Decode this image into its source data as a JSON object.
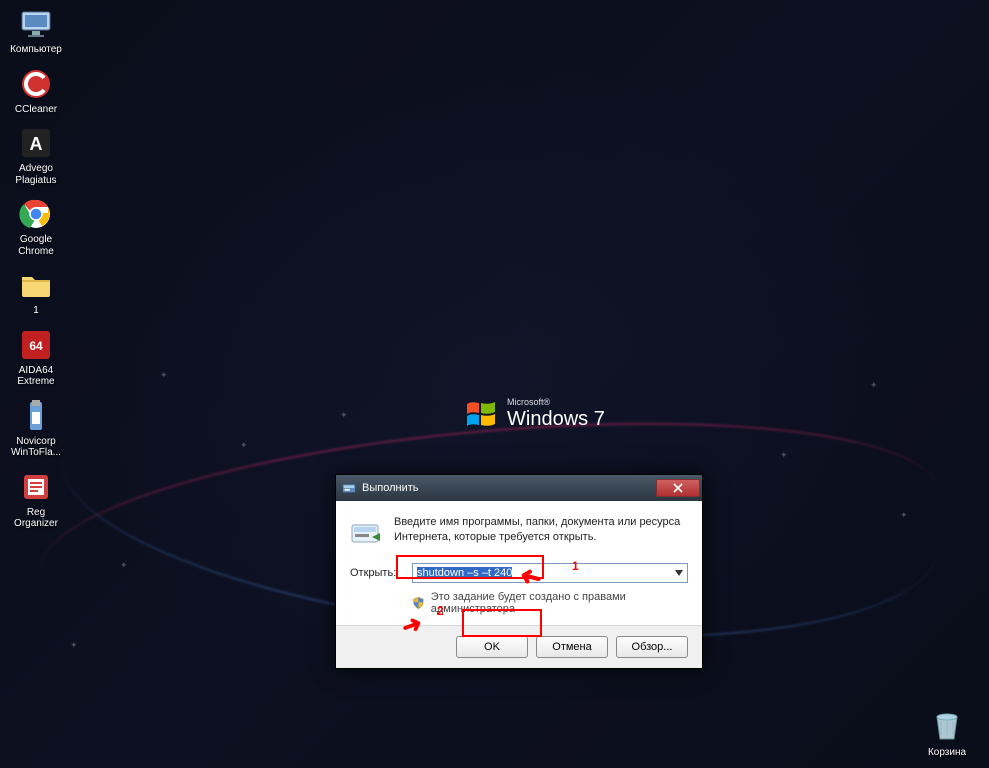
{
  "wallpaper": {
    "brand_small": "Microsoft®",
    "brand_large": "Windows 7"
  },
  "desktop": {
    "icons": [
      {
        "label": "Компьютер",
        "name": "computer-icon"
      },
      {
        "label": "CCleaner",
        "name": "ccleaner-icon"
      },
      {
        "label": "Advego Plagiatus",
        "name": "advego-icon"
      },
      {
        "label": "Google Chrome",
        "name": "chrome-icon"
      },
      {
        "label": "1",
        "name": "folder-icon"
      },
      {
        "label": "AIDA64 Extreme",
        "name": "aida64-icon"
      },
      {
        "label": "Novicorp WinToFla...",
        "name": "wintoflash-icon"
      },
      {
        "label": "Reg Organizer",
        "name": "regorganizer-icon"
      }
    ],
    "recycle_label": "Корзина"
  },
  "run_dialog": {
    "title": "Выполнить",
    "description": "Введите имя программы, папки, документа или ресурса Интернета, которые требуется открыть.",
    "open_label": "Открыть:",
    "command_value": "shutdown –s –t 240",
    "admin_note": "Это задание будет создано с правами администратора",
    "ok_label": "OK",
    "cancel_label": "Отмена",
    "browse_label": "Обзор..."
  },
  "annotations": {
    "num1": "1",
    "num2": "2"
  }
}
